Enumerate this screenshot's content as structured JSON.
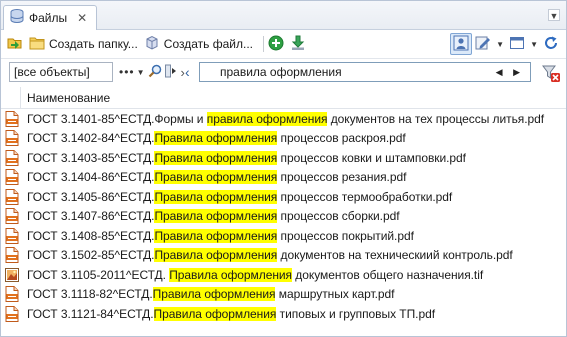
{
  "tab": {
    "label": "Файлы",
    "close": "✕"
  },
  "toolbar": {
    "create_folder": "Создать папку...",
    "create_file": "Создать файл..."
  },
  "filter": {
    "scope": "[все объекты]",
    "dots": "•••",
    "search_value": "правила оформления"
  },
  "list": {
    "column_name": "Наименование",
    "rows": [
      {
        "pre": "ГОСТ 3.1401-85^ЕСТД.Формы и ",
        "hl": "правила оформления",
        "post": " документов на тех процессы литья.pdf",
        "type": "pdf"
      },
      {
        "pre": "ГОСТ 3.1402-84^ЕСТД.",
        "hl": "Правила оформления",
        "post": " процессов раскроя.pdf",
        "type": "pdf"
      },
      {
        "pre": "ГОСТ 3.1403-85^ЕСТД.",
        "hl": "Правила оформления",
        "post": " процессов ковки и штамповки.pdf",
        "type": "pdf"
      },
      {
        "pre": "ГОСТ 3.1404-86^ЕСТД.",
        "hl": "Правила оформления",
        "post": " процессов резания.pdf",
        "type": "pdf"
      },
      {
        "pre": "ГОСТ 3.1405-86^ЕСТД.",
        "hl": "Правила оформления",
        "post": " процессов термообработки.pdf",
        "type": "pdf"
      },
      {
        "pre": "ГОСТ 3.1407-86^ЕСТД.",
        "hl": "Правила оформления",
        "post": " процессов сборки.pdf",
        "type": "pdf"
      },
      {
        "pre": "ГОСТ 3.1408-85^ЕСТД.",
        "hl": "Правила оформления",
        "post": " процессов покрытий.pdf",
        "type": "pdf"
      },
      {
        "pre": "ГОСТ 3.1502-85^ЕСТД.",
        "hl": "Правила оформления",
        "post": " документов на техническиий контроль.pdf",
        "type": "pdf"
      },
      {
        "pre": "ГОСТ 3.1105-2011^ЕСТД. ",
        "hl": "Правила оформления",
        "post": " документов общего назначения.tif",
        "type": "tif"
      },
      {
        "pre": "ГОСТ 3.1118-82^ЕСТД.",
        "hl": "Правила оформления",
        "post": " маршрутных карт.pdf",
        "type": "pdf"
      },
      {
        "pre": "ГОСТ 3.1121-84^ЕСТД.",
        "hl": "Правила оформления",
        "post": " типовых и групповых ТП.pdf",
        "type": "pdf"
      }
    ]
  },
  "colors": {
    "highlight": "#ffff00",
    "accent": "#2f5f9e"
  }
}
